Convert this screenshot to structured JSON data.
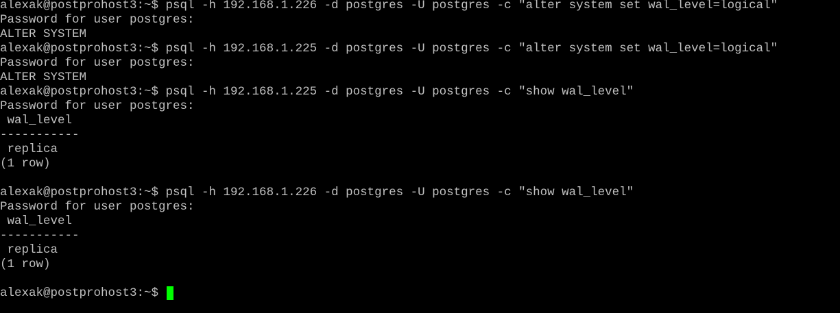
{
  "terminal": {
    "lines": [
      "alexak@postprohost3:~$ psql -h 192.168.1.226 -d postgres -U postgres -c \"alter system set wal_level=logical\"",
      "Password for user postgres:",
      "ALTER SYSTEM",
      "alexak@postprohost3:~$ psql -h 192.168.1.225 -d postgres -U postgres -c \"alter system set wal_level=logical\"",
      "Password for user postgres:",
      "ALTER SYSTEM",
      "alexak@postprohost3:~$ psql -h 192.168.1.225 -d postgres -U postgres -c \"show wal_level\"",
      "Password for user postgres:",
      " wal_level",
      "-----------",
      " replica",
      "(1 row)",
      "",
      "alexak@postprohost3:~$ psql -h 192.168.1.226 -d postgres -U postgres -c \"show wal_level\"",
      "Password for user postgres:",
      " wal_level",
      "-----------",
      " replica",
      "(1 row)",
      "",
      "alexak@postprohost3:~$ "
    ],
    "cursor_color": "#00ff00",
    "text_color": "#c0c0c0",
    "background_color": "#000000"
  }
}
